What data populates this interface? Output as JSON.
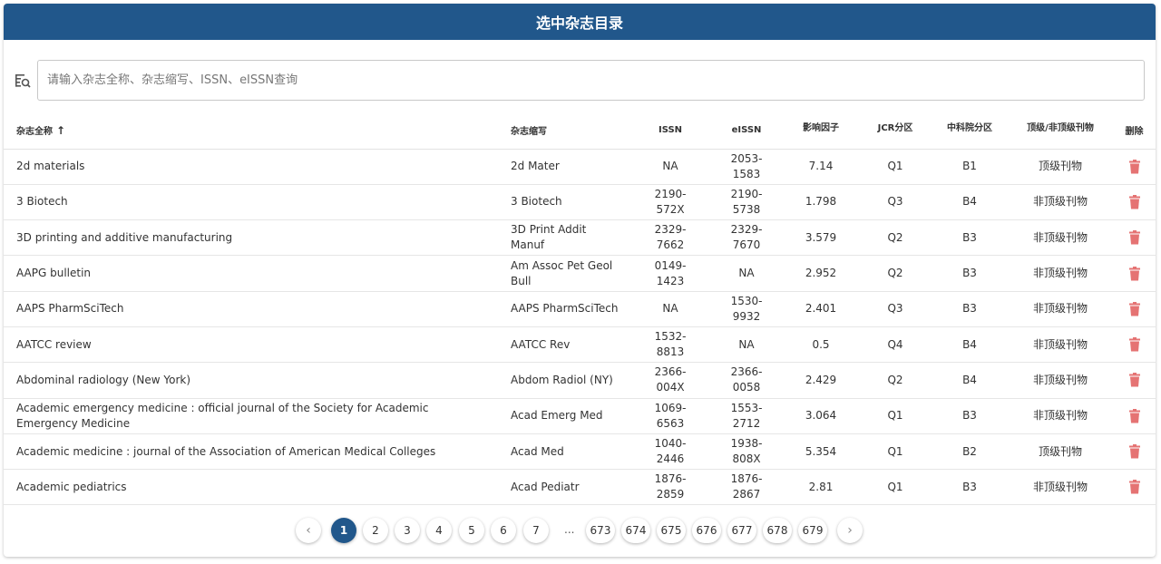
{
  "title": "选中杂志目录",
  "search": {
    "placeholder": "请输入杂志全称、杂志缩写、ISSN、eISSN查询"
  },
  "headers": {
    "full_name": "杂志全称",
    "abbr": "杂志缩写",
    "issn": "ISSN",
    "eissn": "eISSN",
    "impact": "影响因子",
    "jcr": "JCR分区",
    "cas": "中科院分区",
    "top": "顶级/非顶级刊物",
    "delete": "删除"
  },
  "sort_arrow": "↑",
  "rows": [
    {
      "name": "2d materials",
      "abbr": "2d Mater",
      "issn": "NA",
      "eissn": "2053-1583",
      "impact": "7.14",
      "jcr": "Q1",
      "cas": "B1",
      "top": "顶级刊物"
    },
    {
      "name": "3 Biotech",
      "abbr": "3 Biotech",
      "issn": "2190-572X",
      "eissn": "2190-5738",
      "impact": "1.798",
      "jcr": "Q3",
      "cas": "B4",
      "top": "非顶级刊物"
    },
    {
      "name": "3D printing and additive manufacturing",
      "abbr": "3D Print Addit Manuf",
      "issn": "2329-7662",
      "eissn": "2329-7670",
      "impact": "3.579",
      "jcr": "Q2",
      "cas": "B3",
      "top": "非顶级刊物"
    },
    {
      "name": "AAPG bulletin",
      "abbr": "Am Assoc Pet Geol Bull",
      "issn": "0149-1423",
      "eissn": "NA",
      "impact": "2.952",
      "jcr": "Q2",
      "cas": "B3",
      "top": "非顶级刊物"
    },
    {
      "name": "AAPS PharmSciTech",
      "abbr": "AAPS PharmSciTech",
      "issn": "NA",
      "eissn": "1530-9932",
      "impact": "2.401",
      "jcr": "Q3",
      "cas": "B3",
      "top": "非顶级刊物"
    },
    {
      "name": "AATCC review",
      "abbr": "AATCC Rev",
      "issn": "1532-8813",
      "eissn": "NA",
      "impact": "0.5",
      "jcr": "Q4",
      "cas": "B4",
      "top": "非顶级刊物"
    },
    {
      "name": "Abdominal radiology (New York)",
      "abbr": "Abdom Radiol (NY)",
      "issn": "2366-004X",
      "eissn": "2366-0058",
      "impact": "2.429",
      "jcr": "Q2",
      "cas": "B4",
      "top": "非顶级刊物"
    },
    {
      "name": "Academic emergency medicine : official journal of the Society for Academic Emergency Medicine",
      "abbr": "Acad Emerg Med",
      "issn": "1069-6563",
      "eissn": "1553-2712",
      "impact": "3.064",
      "jcr": "Q1",
      "cas": "B3",
      "top": "非顶级刊物"
    },
    {
      "name": "Academic medicine : journal of the Association of American Medical Colleges",
      "abbr": "Acad Med",
      "issn": "1040-2446",
      "eissn": "1938-808X",
      "impact": "5.354",
      "jcr": "Q1",
      "cas": "B2",
      "top": "顶级刊物"
    },
    {
      "name": "Academic pediatrics",
      "abbr": "Acad Pediatr",
      "issn": "1876-2859",
      "eissn": "1876-2867",
      "impact": "2.81",
      "jcr": "Q1",
      "cas": "B3",
      "top": "非顶级刊物"
    }
  ],
  "pagination": {
    "prev": "‹",
    "next": "›",
    "ellipsis": "...",
    "pages_start": [
      "1",
      "2",
      "3",
      "4",
      "5",
      "6",
      "7"
    ],
    "pages_end": [
      "673",
      "674",
      "675",
      "676",
      "677",
      "678",
      "679"
    ],
    "active": "1"
  },
  "colors": {
    "header_bg": "#21578b",
    "delete_icon": "#e57373",
    "active_page": "#21578b"
  }
}
